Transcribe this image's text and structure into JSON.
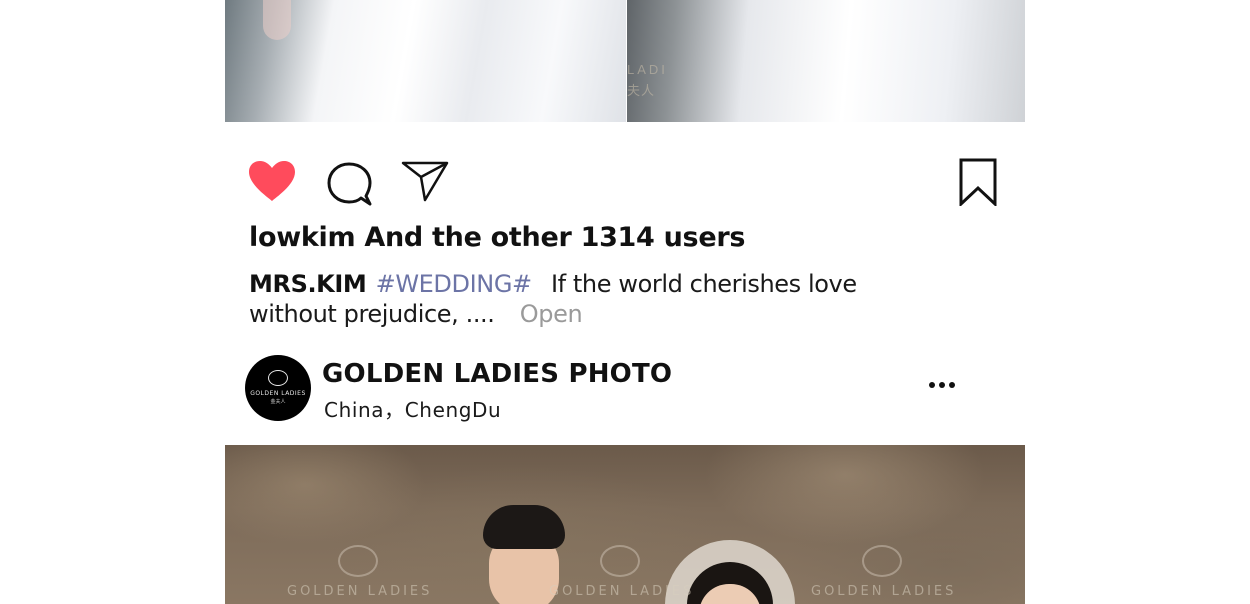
{
  "top_photos": {
    "left_alt": "bride in white gown (left)",
    "right_alt": "bride in white gown (right)",
    "watermark_text": "LADI",
    "watermark_cn": "夫人"
  },
  "actions": {
    "like_icon": "heart-icon",
    "like_color": "#ff4b5c",
    "comment_icon": "comment-icon",
    "share_icon": "share-icon",
    "save_icon": "bookmark-icon"
  },
  "likes": {
    "text": "lowkim And the other 1314 users"
  },
  "caption": {
    "username": "MRS.KIM",
    "hashtag": "#WEDDING#",
    "text": "If the world cherishes love without prejudice, ....",
    "open_label": "Open",
    "hashtag_color": "#6c74a6"
  },
  "next_post": {
    "avatar_logo_text": "GOLDEN LADIES",
    "avatar_logo_cn": "金夫人",
    "account_name": "GOLDEN LADIES PHOTO",
    "location": "China，ChengDu",
    "more_icon": "more-horizontal-icon",
    "watermarks": [
      "GOLDEN LADIES",
      "GOLDEN LADIES",
      "GOLDEN LADIES"
    ]
  }
}
